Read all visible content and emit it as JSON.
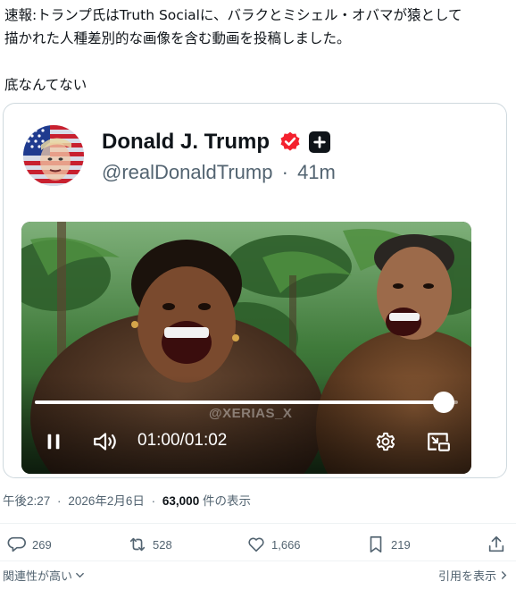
{
  "post": {
    "text_lines": [
      "速報:トランプ氏はTruth Socialに、バラクとミシェル・オバマが猿として",
      "描かれた人種差別的な画像を含む動画を投稿しました。"
    ],
    "comment": "底なんてない"
  },
  "quoted": {
    "display_name": "Donald J. Trump",
    "handle": "@realDonaldTrump",
    "separator": "·",
    "age": "41m",
    "video": {
      "watermark": "@XERIAS_X",
      "time_current": "01:00",
      "time_sep": "/",
      "time_total": "01:02",
      "progress": 0.967,
      "icons": [
        "pause-icon",
        "volume-icon",
        "settings-gear-icon",
        "picture-in-picture-icon"
      ]
    }
  },
  "meta": {
    "time": "午後2:27",
    "dot1": "·",
    "date": "2026年2月6日",
    "dot2": "·",
    "views": "63,000",
    "views_suffix": " 件の表示"
  },
  "actions": {
    "replies": "269",
    "reposts": "528",
    "likes": "1,666",
    "bookmarks": "219"
  },
  "footer": {
    "sort_label": "関連性が高い",
    "quotes_label": "引用を表示"
  },
  "colors": {
    "text": "#0f1419",
    "secondary": "#536471",
    "border": "#cfd9de",
    "verified": "#f4212e"
  }
}
